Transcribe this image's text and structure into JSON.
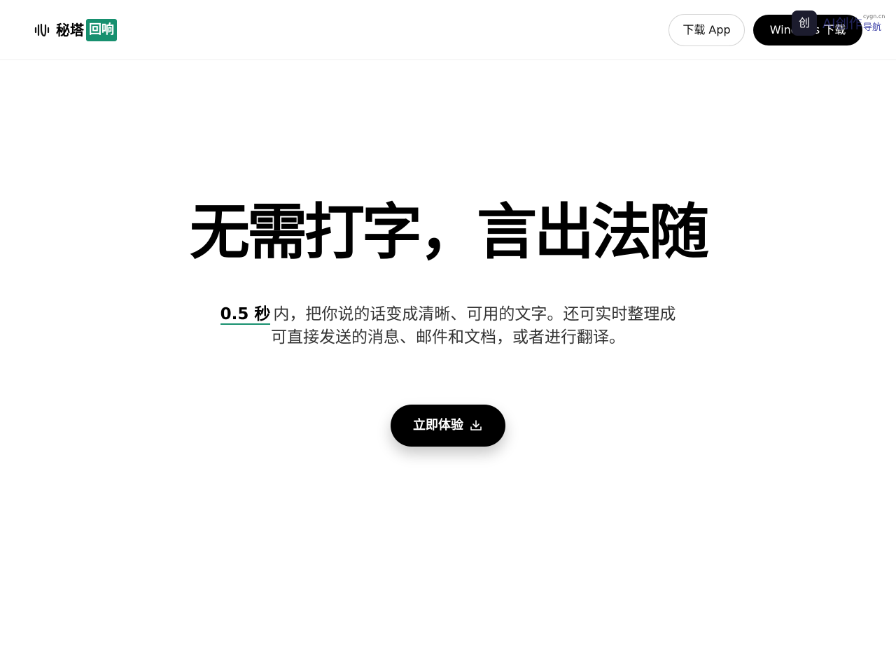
{
  "header": {
    "logo": {
      "name": "秘塔",
      "badge": "回响",
      "icon": "sound-wave-icon"
    },
    "download_app_label": "下载 App",
    "windows_download_label": "Windows 下载",
    "watermark": {
      "icon_glyph": "创",
      "text": "AI创作",
      "sub": "cygn.cn",
      "nav": "导航"
    }
  },
  "hero": {
    "title": "无需打字，言出法随",
    "highlight": "0.5 秒",
    "subtitle_line1": "内，把你说的话变成清晰、可用的文字。还可实时整理成",
    "subtitle_line2": "可直接发送的消息、邮件和文档，或者进行翻译。",
    "cta_label": "立即体验",
    "cta_icon": "download-icon"
  },
  "colors": {
    "accent": "#17906f",
    "primary": "#000000",
    "background": "#ffffff"
  }
}
